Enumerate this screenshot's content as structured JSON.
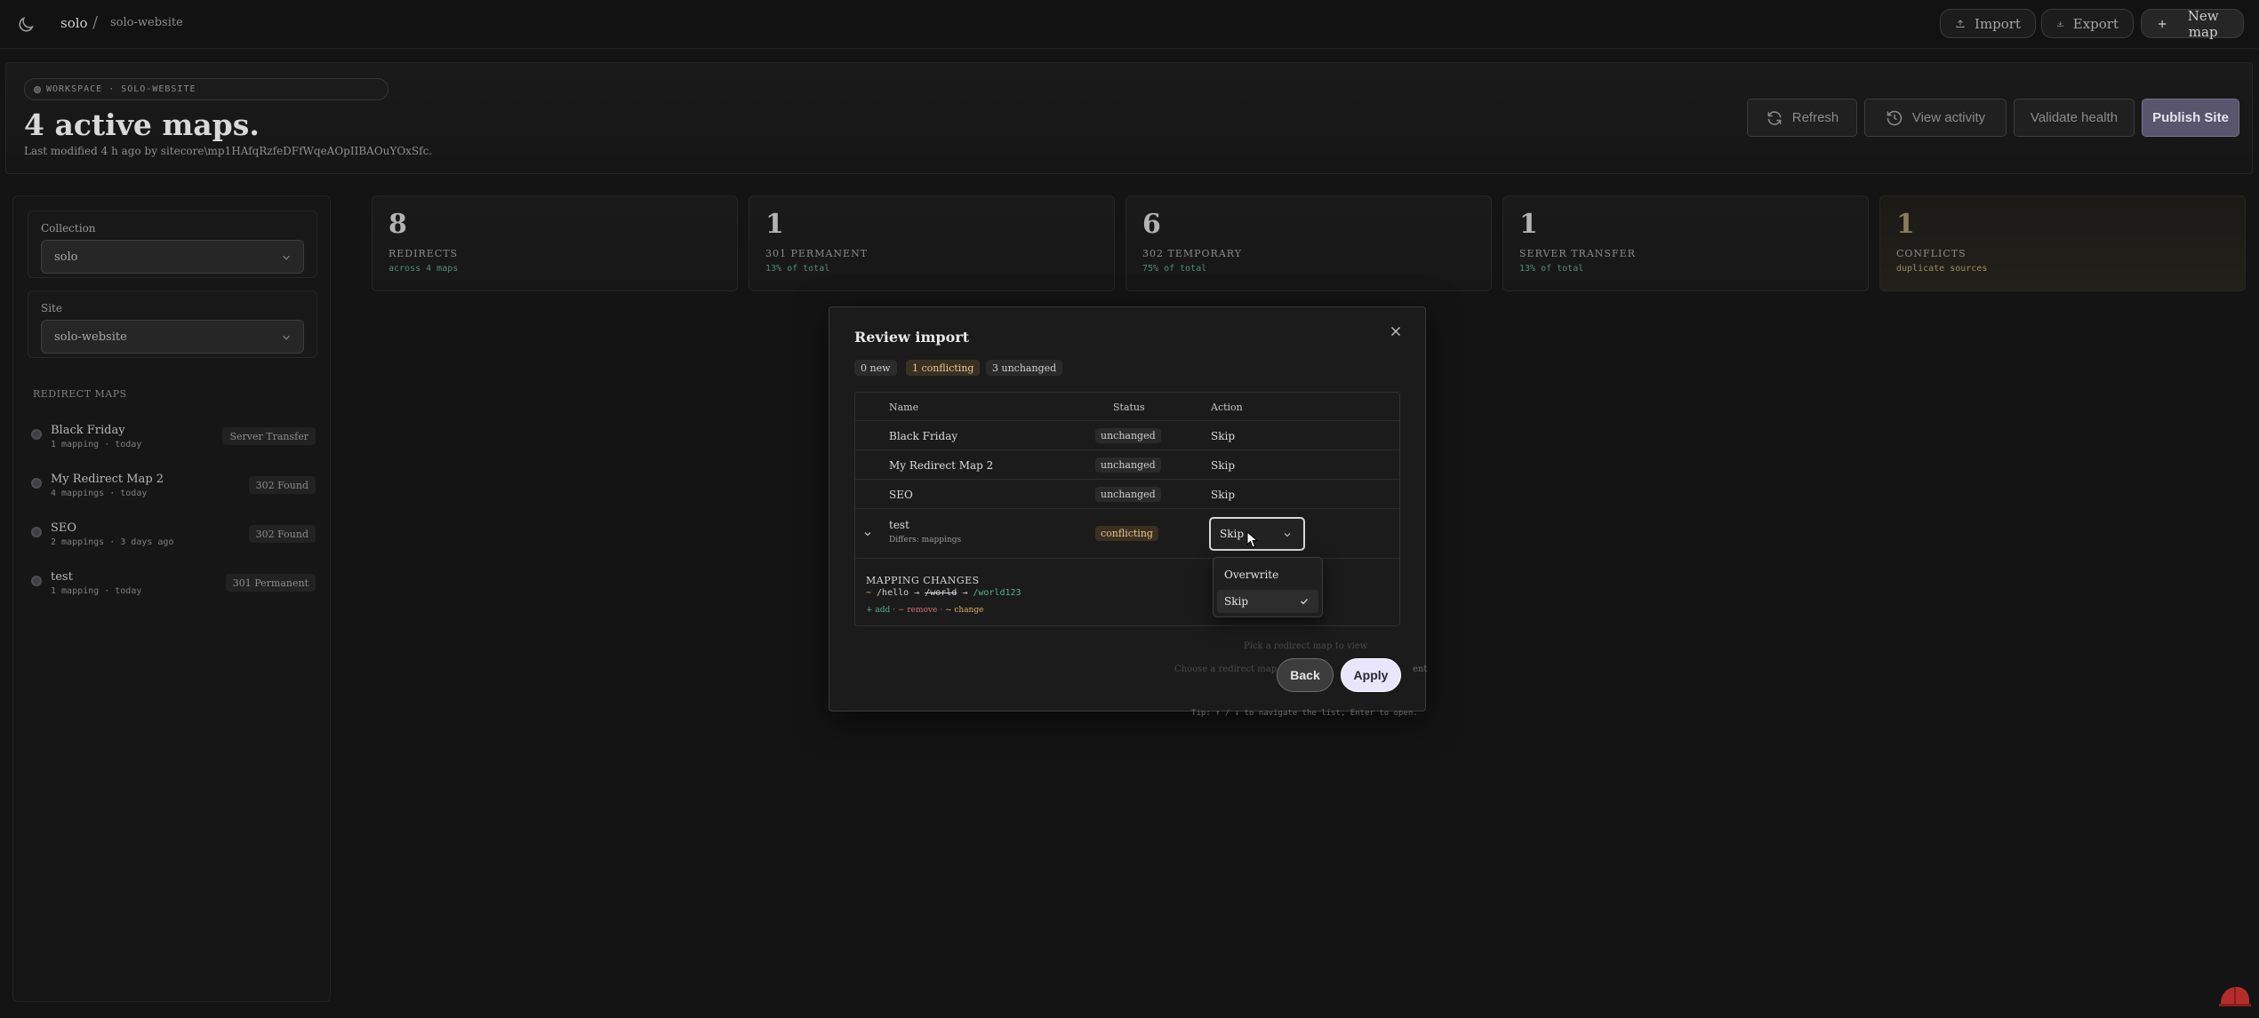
{
  "topbar": {
    "crumb_workspace": "solo",
    "crumb_separator": "/",
    "crumb_site": "solo-website",
    "import_label": "Import",
    "export_label": "Export",
    "new_map_label": "New map"
  },
  "header": {
    "workspace_badge": "WORKSPACE · SOLO-WEBSITE",
    "title": "4 active maps.",
    "subtitle": "Last modified 4 h ago by sitecore\\mp1HAfqRzfeDFfWqeAOpIIBAOuYOxSfc.",
    "refresh_label": "Refresh",
    "view_activity_label": "View activity",
    "validate_health_label": "Validate health",
    "publish_site_label": "Publish Site"
  },
  "sidebar": {
    "collection_label": "Collection",
    "collection_value": "solo",
    "site_label": "Site",
    "site_value": "solo-website",
    "redirect_maps_heading": "REDIRECT MAPS",
    "maps": [
      {
        "name": "Black Friday",
        "meta": "1 mapping · today",
        "badge": "Server Transfer"
      },
      {
        "name": "My Redirect Map 2",
        "meta": "4 mappings · today",
        "badge": "302 Found"
      },
      {
        "name": "SEO",
        "meta": "2 mappings · 3 days ago",
        "badge": "302 Found"
      },
      {
        "name": "test",
        "meta": "1 mapping · today",
        "badge": "301 Permanent"
      }
    ]
  },
  "stats": [
    {
      "value": "8",
      "label": "REDIRECTS",
      "sub": "across 4 maps"
    },
    {
      "value": "1",
      "label": "301 PERMANENT",
      "sub": "13% of total"
    },
    {
      "value": "6",
      "label": "302 TEMPORARY",
      "sub": "75% of total"
    },
    {
      "value": "1",
      "label": "SERVER TRANSFER",
      "sub": "13% of total"
    },
    {
      "value": "1",
      "label": "CONFLICTS",
      "sub": "duplicate sources"
    }
  ],
  "background": {
    "empty_hint": "Pick a redirect map to view",
    "empty_hint_2": "Choose a redirect map",
    "empty_hint_3": "ent",
    "tip": "Tip: ↑ / ↓ to navigate the list, Enter to open."
  },
  "modal": {
    "title": "Review import",
    "chip_new": "0 new",
    "chip_conflicting": "1 conflicting",
    "chip_unchanged": "3 unchanged",
    "col_name": "Name",
    "col_status": "Status",
    "col_action": "Action",
    "rows": [
      {
        "name": "Black Friday",
        "status": "unchanged",
        "action": "Skip"
      },
      {
        "name": "My Redirect Map 2",
        "status": "unchanged",
        "action": "Skip"
      },
      {
        "name": "SEO",
        "status": "unchanged",
        "action": "Skip"
      }
    ],
    "conflict_row": {
      "name": "test",
      "differs": "Differs: mappings",
      "status": "conflicting",
      "action_value": "Skip"
    },
    "mapping_changes": {
      "title": "MAPPING CHANGES",
      "marker": "~",
      "source": "/hello",
      "arrow": "→",
      "old_target": "/world",
      "arrow2": "→",
      "new_target": "/world123",
      "legend_add": "+ add",
      "legend_sep1": "·",
      "legend_remove": "− remove",
      "legend_sep2": "·",
      "legend_change": "~ change"
    },
    "dropdown_options": [
      "Overwrite",
      "Skip"
    ],
    "back_label": "Back",
    "apply_label": "Apply"
  }
}
